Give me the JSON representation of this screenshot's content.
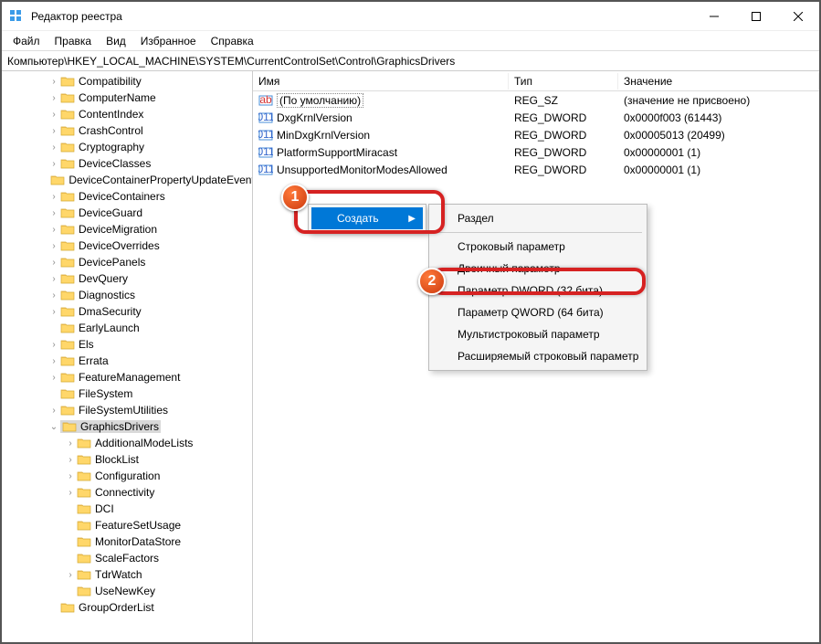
{
  "window": {
    "title": "Редактор реестра"
  },
  "menubar": {
    "items": [
      "Файл",
      "Правка",
      "Вид",
      "Избранное",
      "Справка"
    ]
  },
  "addressbar": {
    "path": "Компьютер\\HKEY_LOCAL_MACHINE\\SYSTEM\\CurrentControlSet\\Control\\GraphicsDrivers"
  },
  "tree": {
    "items": [
      {
        "label": "Compatibility",
        "indent": 50,
        "toggle": ">"
      },
      {
        "label": "ComputerName",
        "indent": 50,
        "toggle": ">"
      },
      {
        "label": "ContentIndex",
        "indent": 50,
        "toggle": ">"
      },
      {
        "label": "CrashControl",
        "indent": 50,
        "toggle": ">"
      },
      {
        "label": "Cryptography",
        "indent": 50,
        "toggle": ">"
      },
      {
        "label": "DeviceClasses",
        "indent": 50,
        "toggle": ">"
      },
      {
        "label": "DeviceContainerPropertyUpdateEvents",
        "indent": 50,
        "toggle": ""
      },
      {
        "label": "DeviceContainers",
        "indent": 50,
        "toggle": ">"
      },
      {
        "label": "DeviceGuard",
        "indent": 50,
        "toggle": ">"
      },
      {
        "label": "DeviceMigration",
        "indent": 50,
        "toggle": ">"
      },
      {
        "label": "DeviceOverrides",
        "indent": 50,
        "toggle": ">"
      },
      {
        "label": "DevicePanels",
        "indent": 50,
        "toggle": ">"
      },
      {
        "label": "DevQuery",
        "indent": 50,
        "toggle": ">"
      },
      {
        "label": "Diagnostics",
        "indent": 50,
        "toggle": ">"
      },
      {
        "label": "DmaSecurity",
        "indent": 50,
        "toggle": ">"
      },
      {
        "label": "EarlyLaunch",
        "indent": 50,
        "toggle": ""
      },
      {
        "label": "Els",
        "indent": 50,
        "toggle": ">"
      },
      {
        "label": "Errata",
        "indent": 50,
        "toggle": ">"
      },
      {
        "label": "FeatureManagement",
        "indent": 50,
        "toggle": ">"
      },
      {
        "label": "FileSystem",
        "indent": 50,
        "toggle": ""
      },
      {
        "label": "FileSystemUtilities",
        "indent": 50,
        "toggle": ">"
      },
      {
        "label": "GraphicsDrivers",
        "indent": 50,
        "toggle": "v",
        "selected": true
      },
      {
        "label": "AdditionalModeLists",
        "indent": 68,
        "toggle": ">"
      },
      {
        "label": "BlockList",
        "indent": 68,
        "toggle": ">"
      },
      {
        "label": "Configuration",
        "indent": 68,
        "toggle": ">"
      },
      {
        "label": "Connectivity",
        "indent": 68,
        "toggle": ">"
      },
      {
        "label": "DCI",
        "indent": 68,
        "toggle": ""
      },
      {
        "label": "FeatureSetUsage",
        "indent": 68,
        "toggle": ""
      },
      {
        "label": "MonitorDataStore",
        "indent": 68,
        "toggle": ""
      },
      {
        "label": "ScaleFactors",
        "indent": 68,
        "toggle": ""
      },
      {
        "label": "TdrWatch",
        "indent": 68,
        "toggle": ">"
      },
      {
        "label": "UseNewKey",
        "indent": 68,
        "toggle": ""
      },
      {
        "label": "GroupOrderList",
        "indent": 50,
        "toggle": ""
      }
    ]
  },
  "list": {
    "headers": {
      "name": "Имя",
      "type": "Тип",
      "value": "Значение"
    },
    "rows": [
      {
        "icon": "ab",
        "name": "(По умолчанию)",
        "type": "REG_SZ",
        "value": "(значение не присвоено)",
        "default": true
      },
      {
        "icon": "bin",
        "name": "DxgKrnlVersion",
        "type": "REG_DWORD",
        "value": "0x0000f003 (61443)"
      },
      {
        "icon": "bin",
        "name": "MinDxgKrnlVersion",
        "type": "REG_DWORD",
        "value": "0x00005013 (20499)"
      },
      {
        "icon": "bin",
        "name": "PlatformSupportMiracast",
        "type": "REG_DWORD",
        "value": "0x00000001 (1)"
      },
      {
        "icon": "bin",
        "name": "UnsupportedMonitorModesAllowed",
        "type": "REG_DWORD",
        "value": "0x00000001 (1)"
      }
    ]
  },
  "context_menu1": {
    "items": [
      {
        "label": "Создать",
        "highlighted": true,
        "arrow": true
      }
    ]
  },
  "context_menu2": {
    "items": [
      {
        "label": "Раздел"
      },
      {
        "sep": true
      },
      {
        "label": "Строковый параметр"
      },
      {
        "label": "Двоичный параметр"
      },
      {
        "label": "Параметр DWORD (32 бита)"
      },
      {
        "label": "Параметр QWORD (64 бита)"
      },
      {
        "label": "Мультистроковый параметр"
      },
      {
        "label": "Расширяемый строковый параметр"
      }
    ]
  },
  "badges": {
    "one": "1",
    "two": "2"
  }
}
